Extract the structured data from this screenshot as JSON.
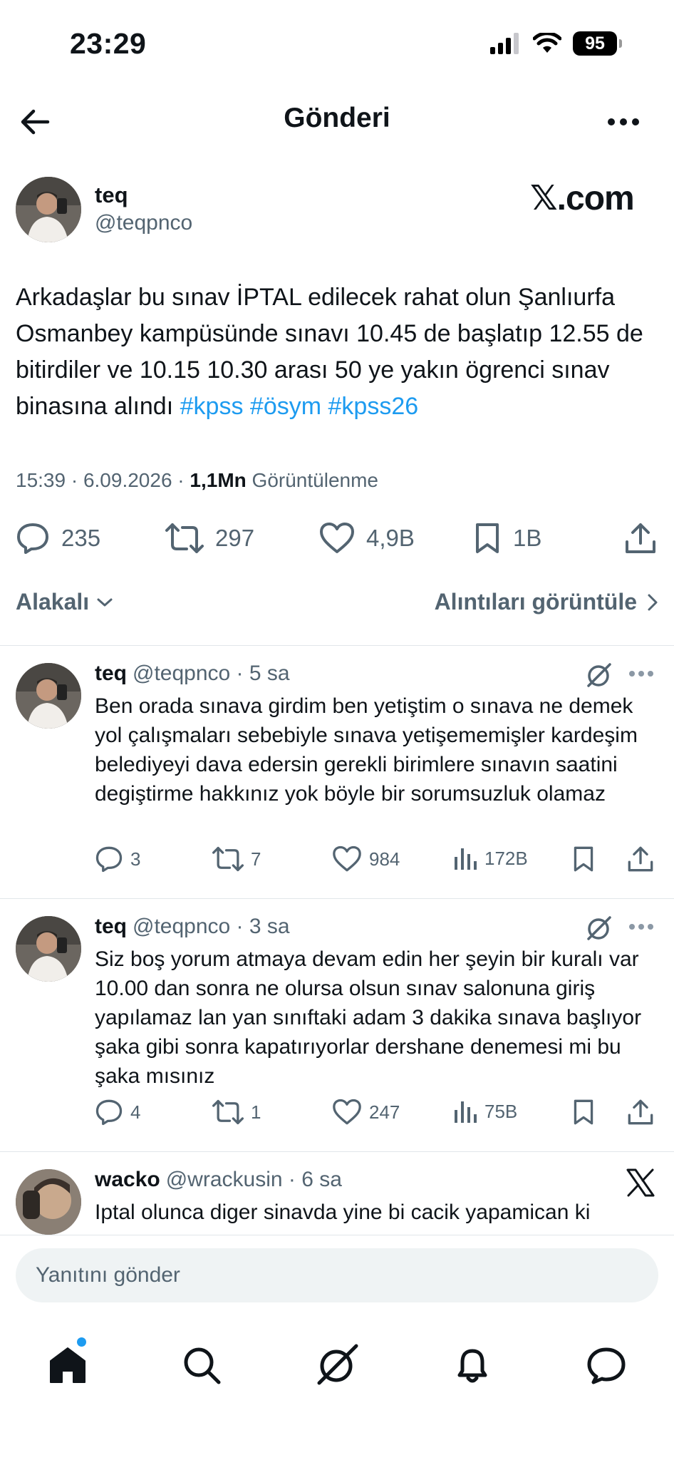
{
  "status_bar": {
    "time": "23:29",
    "battery": "95"
  },
  "header": {
    "title": "Gönderi"
  },
  "main_tweet": {
    "name": "teq",
    "handle": "@teqpnco",
    "watermark": "𝕏.com",
    "text_parts": [
      "Arkadaşlar bu sınav İPTAL edilecek rahat olun Şanlıurfa Osmanbey kampüsünde sınavı 10.45 de başlatıp 12.55 de bitirdiler ve 10.15 10.30 arası 50 ye yakın ögrenci sınav binasına alındı ",
      "#kpss",
      " ",
      "#ösym",
      " ",
      "#kpss26"
    ],
    "time": "15:39 · 6.09.2026 · ",
    "views": "1,1Mn",
    "views_label": " Görüntülenme",
    "stats": {
      "replies": "235",
      "reposts": "297",
      "likes": "4,9B",
      "bookmarks": "1B"
    }
  },
  "sort": {
    "left_label": "Alakalı",
    "right_label": "Alıntıları görüntüle"
  },
  "replies": [
    {
      "name": "teq",
      "handle": "@teqpnco · 5 sa",
      "text": "Ben orada sınava girdim ben yetiştim o sınava ne demek yol çalışmaları sebebiyle sınava yetişememişler kardeşim belediyeyi dava edersin gerekli birimlere sınavın saatini degiştirme hakkınız yok böyle bir sorumsuzluk olamaz",
      "replies": "3",
      "reposts": "7",
      "likes": "984",
      "views": "172B"
    },
    {
      "name": "teq",
      "handle": "@teqpnco · 3 sa",
      "text": "Siz boş yorum atmaya devam edin her şeyin bir kuralı var 10.00 dan sonra ne olursa olsun sınav salonuna giriş yapılamaz lan yan sınıftaki adam 3 dakika sınava başlıyor şaka gibi sonra kapatırıyorlar dershane denemesi mi bu şaka mısınız",
      "replies": "4",
      "reposts": "1",
      "likes": "247",
      "views": "75B"
    },
    {
      "name": "wacko",
      "handle": "@wrackusin · 6 sa",
      "text": "Iptal olunca diger sinavda yine bi cacik yapamican ki"
    }
  ],
  "composer": {
    "placeholder": "Yanıtını gönder"
  },
  "colors": {
    "accent": "#1d9bf0",
    "secondary_text": "#536471",
    "text": "#0f1419"
  }
}
